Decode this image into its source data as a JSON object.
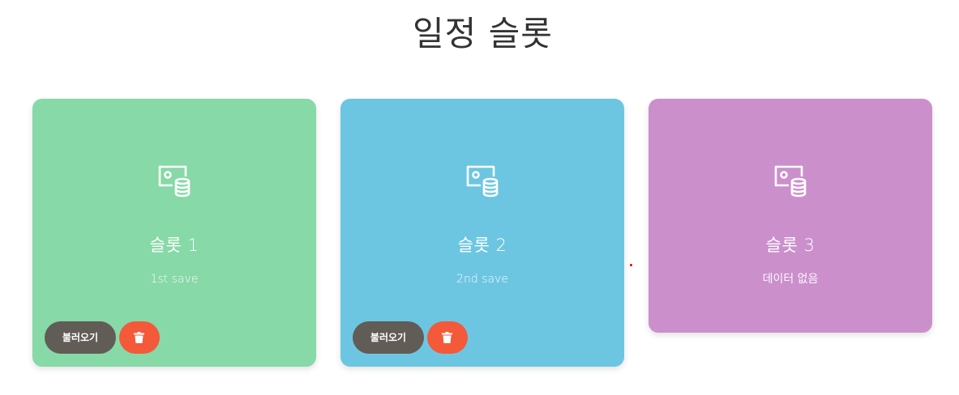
{
  "page": {
    "title": "일정 슬롯"
  },
  "slots": [
    {
      "name": "슬롯 1",
      "description": "1st save",
      "color": "#87d9a8",
      "icon": "save-database-icon",
      "load_label": "불러오기",
      "delete_icon": "trash-icon"
    },
    {
      "name": "슬롯 2",
      "description": "2nd save",
      "color": "#6dc6e1",
      "icon": "save-database-icon",
      "load_label": "불러오기",
      "delete_icon": "trash-icon"
    },
    {
      "name": "슬롯 3",
      "description": "데이터 없음",
      "color": "#cb90cc",
      "icon": "save-database-icon"
    }
  ],
  "colors": {
    "load_button": "#625c56",
    "delete_button": "#f4593a",
    "title_text": "#333333"
  }
}
